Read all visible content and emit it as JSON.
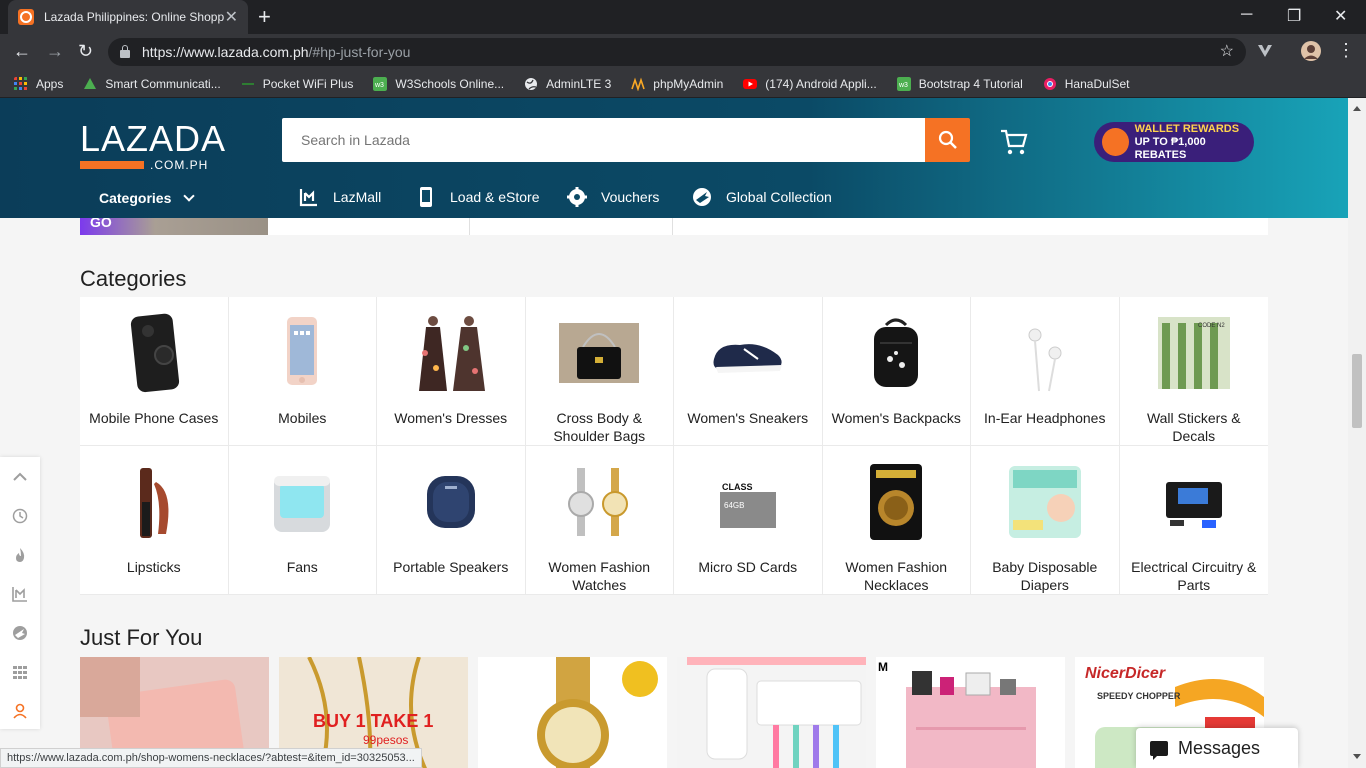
{
  "browser": {
    "tab_title": "Lazada Philippines: Online Shopp",
    "url_main": "https://www.lazada.com.ph",
    "url_rest": "/#hp-just-for-you",
    "bookmarks": [
      {
        "label": "Apps",
        "icon": "apps-grid-icon",
        "color": "#e53935"
      },
      {
        "label": "Smart Communicati...",
        "icon": "smart-icon",
        "color": "#4caf50"
      },
      {
        "label": "Pocket WiFi Plus",
        "icon": "wifi-icon",
        "color": "#2e7d32"
      },
      {
        "label": "W3Schools Online...",
        "icon": "w3schools-icon",
        "color": "#4caf50"
      },
      {
        "label": "AdminLTE 3",
        "icon": "globe-icon",
        "color": "#e8eaed"
      },
      {
        "label": "phpMyAdmin",
        "icon": "phpmyadmin-icon",
        "color": "#f9a825"
      },
      {
        "label": "(174) Android Appli...",
        "icon": "youtube-icon",
        "color": "#ff0000"
      },
      {
        "label": "Bootstrap 4 Tutorial",
        "icon": "w3schools-icon",
        "color": "#4caf50"
      },
      {
        "label": "HanaDulSet",
        "icon": "chrome-icon",
        "color": "#e91e63"
      }
    ],
    "status_url": "https://www.lazada.com.ph/shop-womens-necklaces/?abtest=&item_id=30325053..."
  },
  "header": {
    "logo_word": "LAZADA",
    "logo_domain": ".COM.PH",
    "search_placeholder": "Search in Lazada",
    "promo_line1": "WALLET REWARDS",
    "promo_line2": "UP TO ₱1,000 REBATES",
    "categories_label": "Categories",
    "nav": [
      {
        "label": "LazMall",
        "icon": "lazmall-icon"
      },
      {
        "label": "Load & eStore",
        "icon": "phone-load-icon"
      },
      {
        "label": "Vouchers",
        "icon": "voucher-gear-icon"
      },
      {
        "label": "Global Collection",
        "icon": "plane-globe-icon"
      }
    ],
    "colors": {
      "accent": "#f57224",
      "header_dark": "#0b3d59",
      "header_light": "#18a3b8"
    }
  },
  "strip": {
    "go_label": "GO"
  },
  "sections": {
    "categories_title": "Categories",
    "just_for_you_title": "Just For You"
  },
  "categories": [
    {
      "name": "Mobile Phone Cases",
      "icon": "phone-case-icon"
    },
    {
      "name": "Mobiles",
      "icon": "smartphone-icon"
    },
    {
      "name": "Women's Dresses",
      "icon": "dress-icon"
    },
    {
      "name": "Cross Body & Shoulder Bags",
      "icon": "handbag-icon"
    },
    {
      "name": "Women's Sneakers",
      "icon": "sneaker-icon"
    },
    {
      "name": "Women's Backpacks",
      "icon": "backpack-icon"
    },
    {
      "name": "In-Ear Headphones",
      "icon": "earphones-icon"
    },
    {
      "name": "Wall Stickers & Decals",
      "icon": "wall-sticker-icon"
    },
    {
      "name": "Lipsticks",
      "icon": "lipstick-icon"
    },
    {
      "name": "Fans",
      "icon": "fan-icon"
    },
    {
      "name": "Portable Speakers",
      "icon": "speaker-icon"
    },
    {
      "name": "Women Fashion Watches",
      "icon": "watch-icon"
    },
    {
      "name": "Micro SD Cards",
      "icon": "sd-card-icon"
    },
    {
      "name": "Women Fashion Necklaces",
      "icon": "necklace-icon"
    },
    {
      "name": "Baby Disposable Diapers",
      "icon": "diaper-icon"
    },
    {
      "name": "Electrical Circuitry & Parts",
      "icon": "circuit-icon"
    }
  ],
  "just_for_you": [
    {
      "caption": "",
      "icon": "wallet-product-icon"
    },
    {
      "caption": "BUY 1 TAKE 1",
      "subcaption": "99pesos",
      "icon": "gold-chain-icon"
    },
    {
      "caption": "",
      "icon": "gold-watch-icon"
    },
    {
      "caption": "",
      "icon": "toothbrush-holder-icon"
    },
    {
      "caption": "",
      "icon": "cosmetic-organizer-icon"
    },
    {
      "caption": "NicerDicer",
      "subcaption": "SPEEDY CHOPPER",
      "icon": "chopper-icon"
    }
  ],
  "sidebar": {
    "items": [
      "back-to-top-icon",
      "history-icon",
      "flame-icon",
      "lazmall-icon",
      "global-icon",
      "grid-icon",
      "account-icon"
    ]
  },
  "messages": {
    "label": "Messages"
  }
}
